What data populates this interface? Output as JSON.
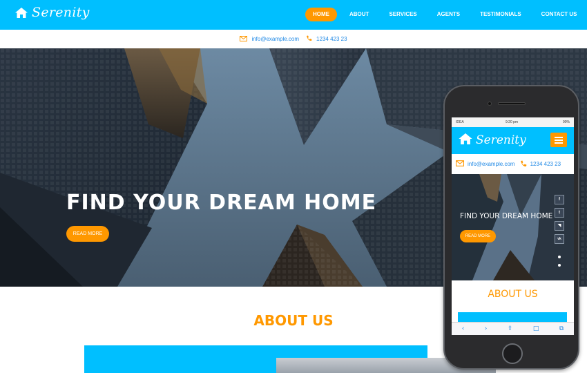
{
  "brand": {
    "name": "Serenity",
    "logo_icon": "home-icon"
  },
  "nav": {
    "items": [
      {
        "label": "HOME",
        "active": true
      },
      {
        "label": "ABOUT",
        "active": false
      },
      {
        "label": "SERVICES",
        "active": false
      },
      {
        "label": "AGENTS",
        "active": false
      },
      {
        "label": "TESTIMONIALS",
        "active": false
      },
      {
        "label": "CONTACT US",
        "active": false
      }
    ]
  },
  "contact": {
    "email": "info@example.com",
    "phone": "1234 423 23",
    "email_icon": "envelope-icon",
    "phone_icon": "phone-icon"
  },
  "hero": {
    "title": "FIND YOUR DREAM HOME",
    "button_label": "READ MORE"
  },
  "about": {
    "title": "ABOUT US"
  },
  "mobile": {
    "status": {
      "carrier": "IDEA",
      "time": "9:20 pm",
      "battery": "90%"
    },
    "brand": "Serenity",
    "contact": {
      "email": "info@example.com",
      "phone": "1234 423 23"
    },
    "hero": {
      "title": "FIND YOUR DREAM HOME",
      "button_label": "READ MORE"
    },
    "social": [
      {
        "icon": "facebook-icon",
        "glyph": "f"
      },
      {
        "icon": "twitter-icon",
        "glyph": "t"
      },
      {
        "icon": "rss-icon",
        "glyph": "◥"
      },
      {
        "icon": "vk-icon",
        "glyph": "vk"
      }
    ],
    "about_title": "ABOUT US",
    "toolbar": [
      {
        "icon": "back-icon",
        "glyph": "‹"
      },
      {
        "icon": "forward-icon",
        "glyph": "›"
      },
      {
        "icon": "share-icon",
        "glyph": "⇪"
      },
      {
        "icon": "bookmarks-icon",
        "glyph": "□"
      },
      {
        "icon": "tabs-icon",
        "glyph": "⧉"
      }
    ]
  },
  "colors": {
    "primary": "#00bfff",
    "accent": "#ff9800",
    "contact_text": "#1e88e5"
  }
}
